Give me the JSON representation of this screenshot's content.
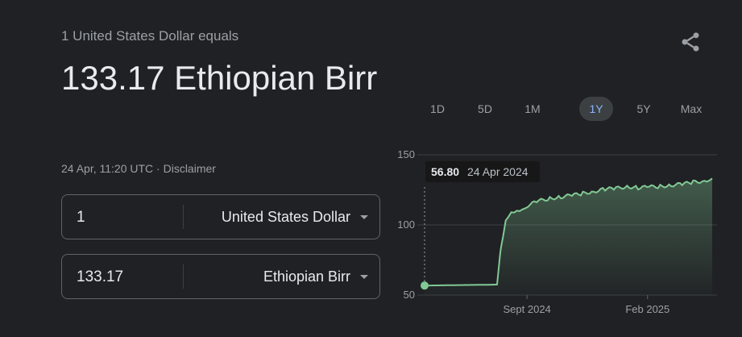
{
  "converter": {
    "equals_line": "1 United States Dollar equals",
    "result_value": "133.17 Ethiopian Birr",
    "timestamp": "24 Apr, 11:20 UTC",
    "separator": " · ",
    "disclaimer": "Disclaimer",
    "from": {
      "amount": "1",
      "currency": "United States Dollar"
    },
    "to": {
      "amount": "133.17",
      "currency": "Ethiopian Birr"
    }
  },
  "share_icon": "share-icon",
  "ranges": {
    "items": [
      "1D",
      "5D",
      "1M",
      "1Y",
      "5Y",
      "Max"
    ],
    "selected": "1Y"
  },
  "colors": {
    "line": "#81c995",
    "active_range_text": "#8ab4f8",
    "background": "#202124"
  },
  "chart_data": {
    "type": "area",
    "series": [
      {
        "x": [
          "2024-04-24",
          "2024-05-08",
          "2024-05-22",
          "2024-06-05",
          "2024-06-19",
          "2024-07-03",
          "2024-07-17",
          "2024-07-25",
          "2024-07-29",
          "2024-07-30",
          "2024-08-05",
          "2024-08-12",
          "2024-08-19",
          "2024-08-26",
          "2024-09-02",
          "2024-09-16",
          "2024-09-30",
          "2024-10-14",
          "2024-10-28",
          "2024-11-11",
          "2024-11-25",
          "2024-12-09",
          "2024-12-23",
          "2025-01-06",
          "2025-01-20",
          "2025-02-03",
          "2025-02-17",
          "2025-03-03",
          "2025-03-17",
          "2025-03-31",
          "2025-04-14",
          "2025-04-24"
        ],
        "values": [
          56.8,
          56.9,
          57.0,
          57.1,
          57.2,
          57.3,
          57.4,
          57.5,
          80.0,
          84.0,
          102.0,
          108.0,
          110.0,
          112.0,
          114.0,
          117.0,
          119.0,
          120.0,
          121.0,
          122.5,
          124.0,
          125.5,
          126.0,
          127.5,
          126.5,
          127.0,
          127.5,
          128.5,
          129.0,
          130.5,
          131.5,
          133.17
        ]
      }
    ],
    "x_tick_labels": [
      "Sept 2024",
      "Feb 2025"
    ],
    "y_ticks": [
      50,
      100,
      150
    ],
    "ylim": [
      50,
      150
    ],
    "grid": true,
    "tooltip": {
      "value": "56.80",
      "date": "24 Apr 2024"
    }
  }
}
